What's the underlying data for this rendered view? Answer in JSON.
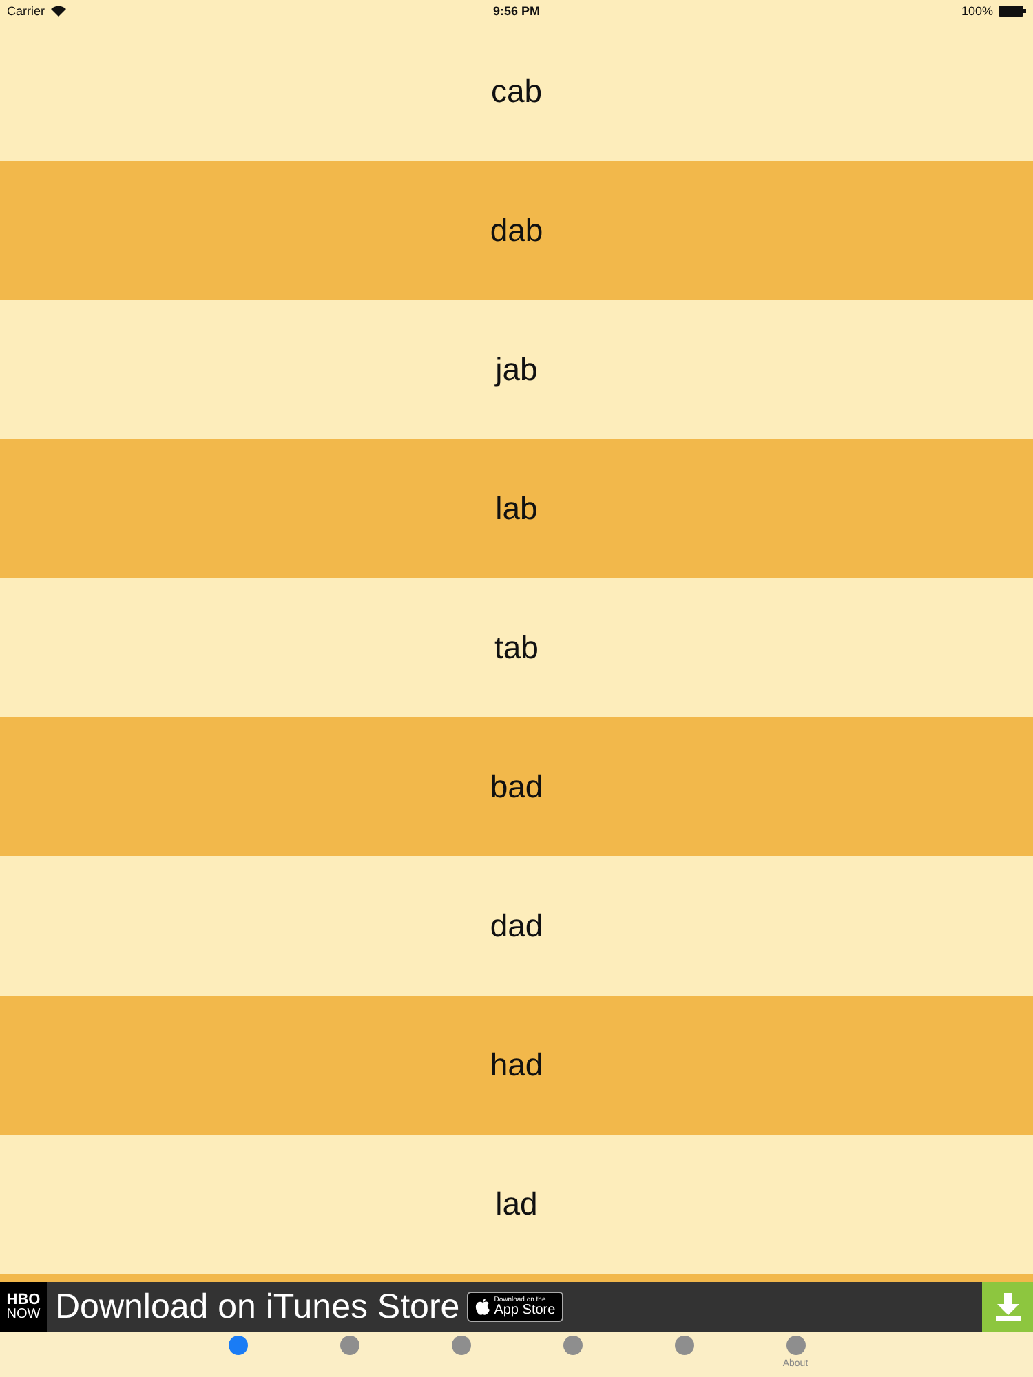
{
  "status_bar": {
    "carrier": "Carrier",
    "time": "9:56 PM",
    "battery": "100%"
  },
  "rows": [
    {
      "word": "cab",
      "color": "#fdedbb"
    },
    {
      "word": "dab",
      "color": "#f2b84b"
    },
    {
      "word": "jab",
      "color": "#fdedbb"
    },
    {
      "word": "lab",
      "color": "#f2b84b"
    },
    {
      "word": "tab",
      "color": "#fdedbb"
    },
    {
      "word": "bad",
      "color": "#f2b84b"
    },
    {
      "word": "dad",
      "color": "#fdedbb"
    },
    {
      "word": "had",
      "color": "#f2b84b"
    },
    {
      "word": "lad",
      "color": "#fdedbb"
    }
  ],
  "ad": {
    "logo_top": "HBO",
    "logo_bottom": "NOW",
    "text": "Download on iTunes Store",
    "badge_small": "Download on the",
    "badge_big": "App Store"
  },
  "tabs": [
    {
      "selected": true
    },
    {
      "selected": false
    },
    {
      "selected": false
    },
    {
      "selected": false
    },
    {
      "selected": false
    },
    {
      "selected": false,
      "label": "About"
    }
  ]
}
